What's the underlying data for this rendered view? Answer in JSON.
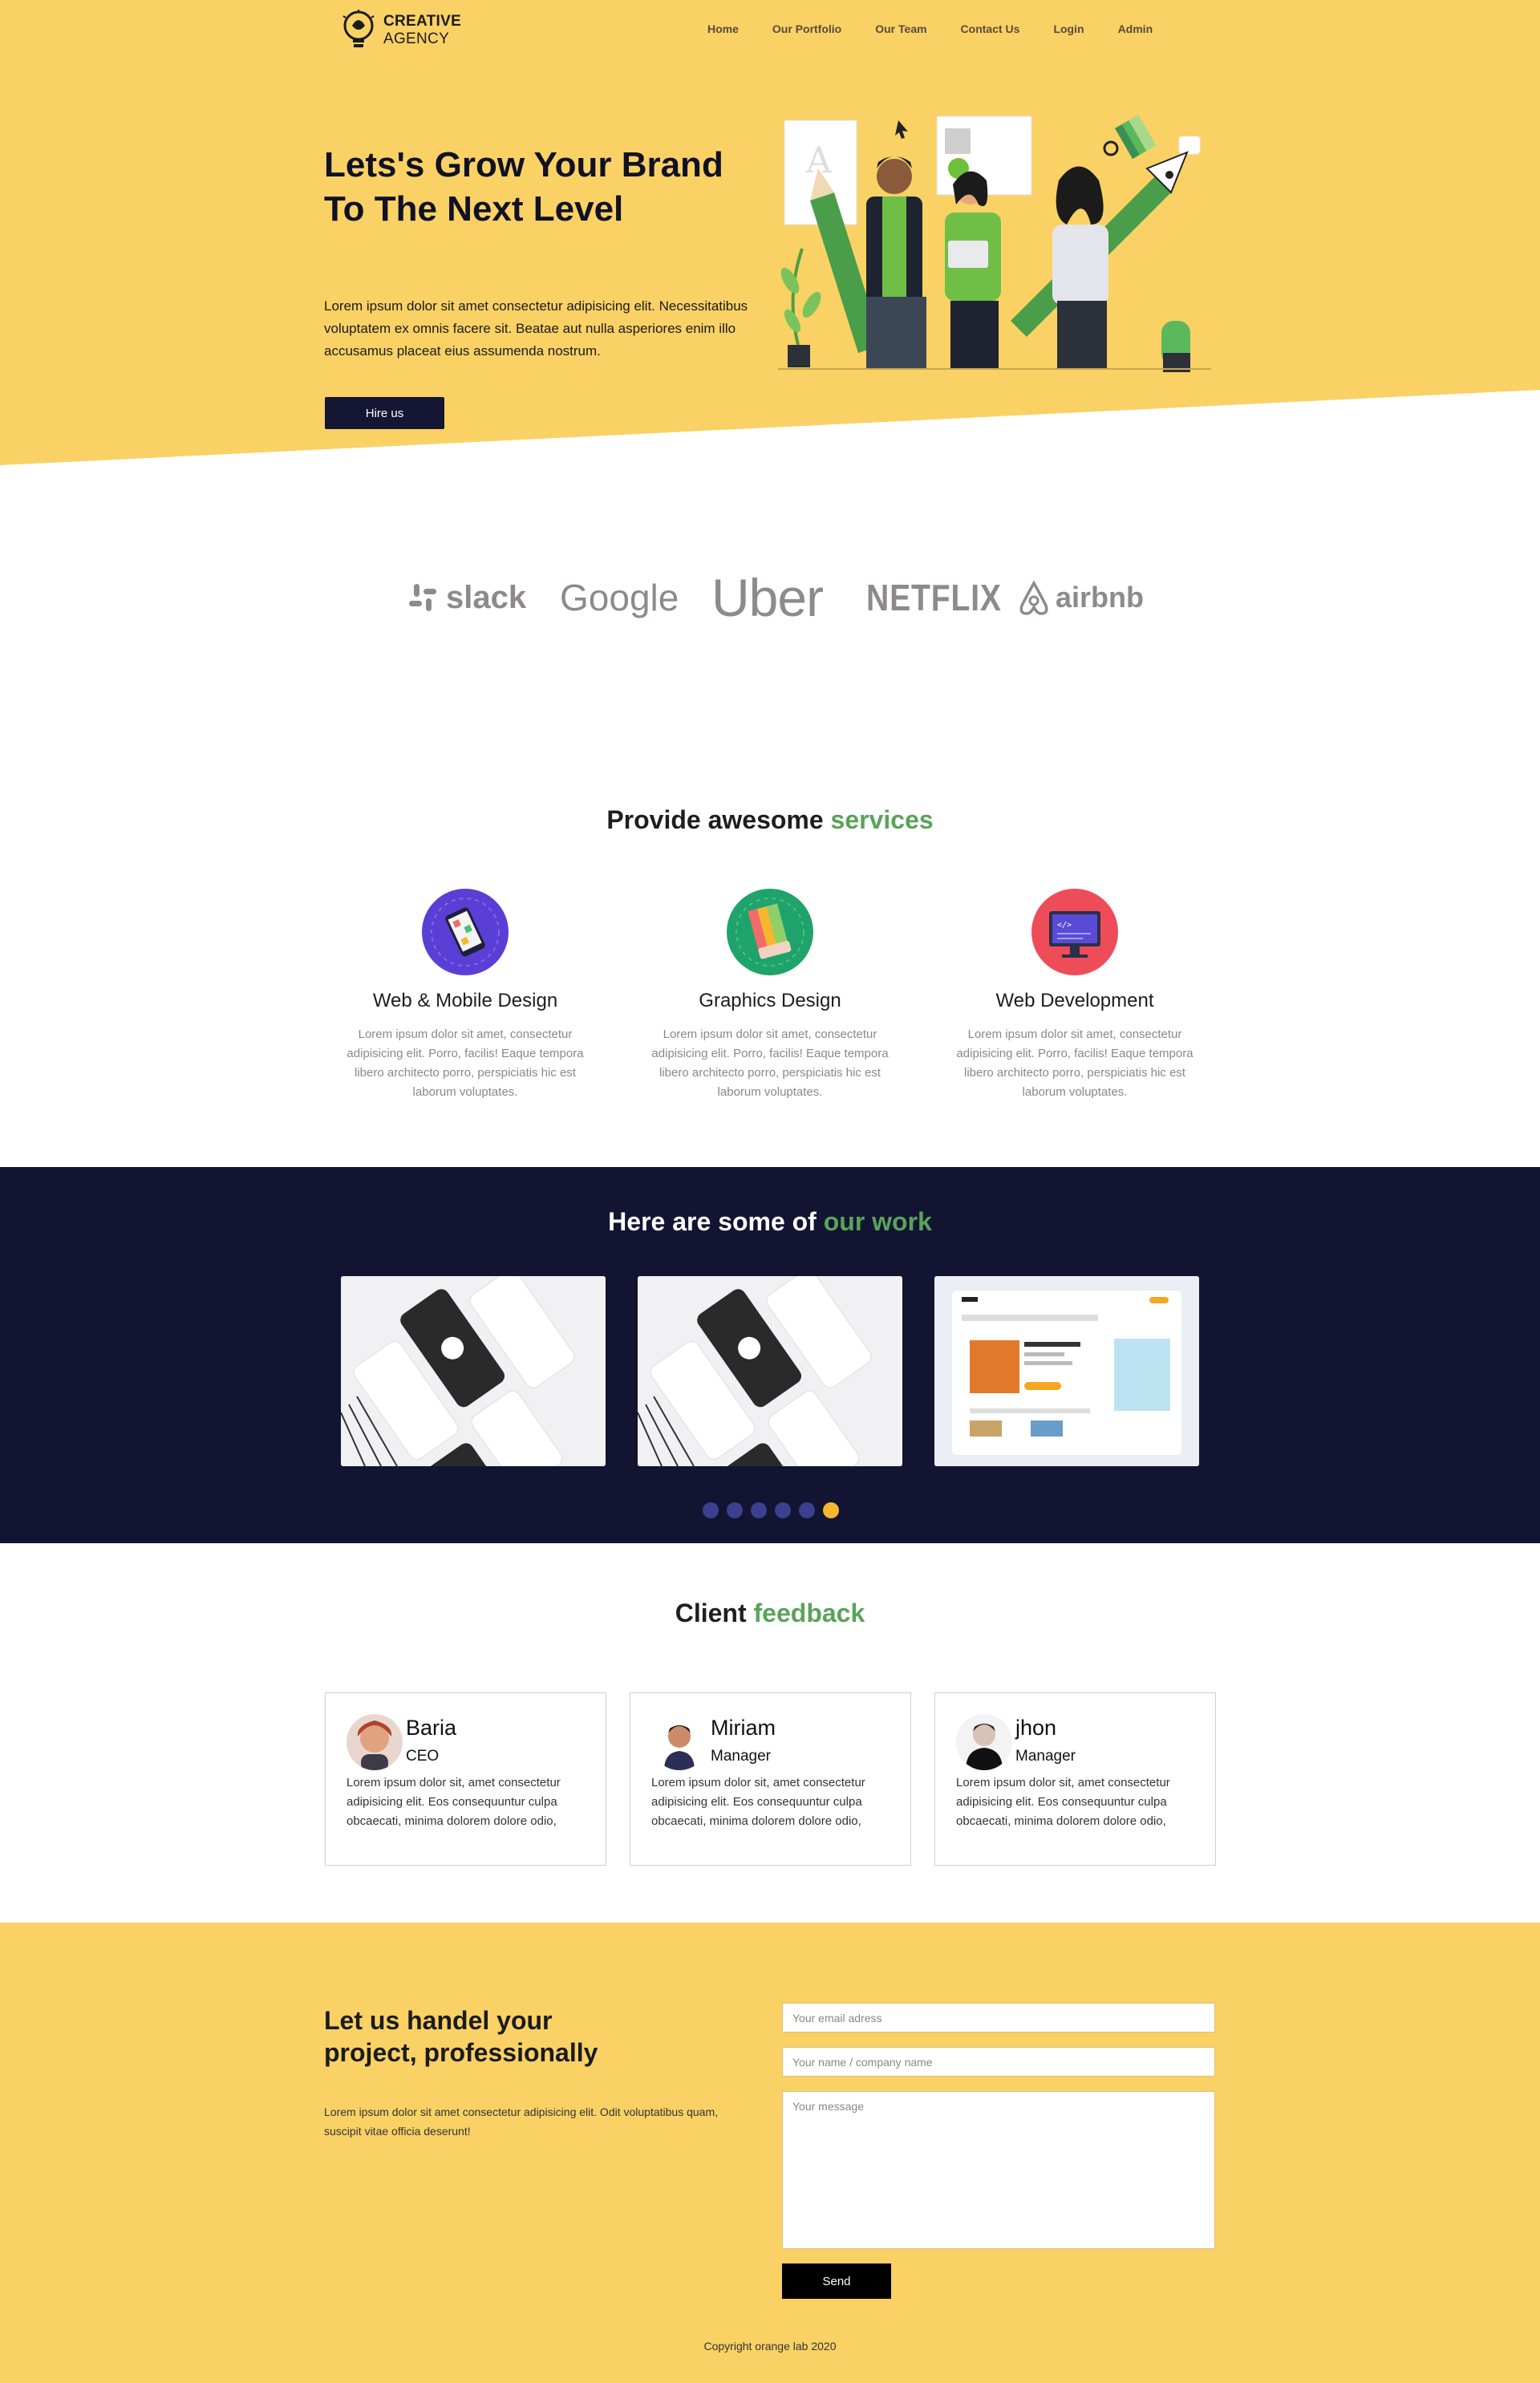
{
  "brand": {
    "name_line1": "CREATIVE",
    "name_line2": "AGENCY"
  },
  "nav": [
    {
      "label": "Home"
    },
    {
      "label": "Our Portfolio"
    },
    {
      "label": "Our Team"
    },
    {
      "label": "Contact Us"
    },
    {
      "label": "Login"
    },
    {
      "label": "Admin"
    }
  ],
  "hero": {
    "title": "Lets's Grow Your Brand To The Next Level",
    "text": "Lorem ipsum dolor sit amet consectetur adipisicing elit. Necessitatibus voluptatem ex omnis facere sit. Beatae aut nulla asperiores enim illo accusamus placeat eius assumenda nostrum.",
    "button": "Hire us"
  },
  "clients": [
    "slack",
    "Google",
    "Uber",
    "NETFLIX",
    "airbnb"
  ],
  "services": {
    "title_plain": "Provide awesome ",
    "title_accent": "services",
    "items": [
      {
        "name": "Web & Mobile Design",
        "desc": "Lorem ipsum dolor sit amet, consectetur adipisicing elit. Porro, facilis! Eaque tempora libero architecto porro, perspiciatis hic est laborum voluptates."
      },
      {
        "name": "Graphics Design",
        "desc": "Lorem ipsum dolor sit amet, consectetur adipisicing elit. Porro, facilis! Eaque tempora libero architecto porro, perspiciatis hic est laborum voluptates."
      },
      {
        "name": "Web Development",
        "desc": "Lorem ipsum dolor sit amet, consectetur adipisicing elit. Porro, facilis! Eaque tempora libero architecto porro, perspiciatis hic est laborum voluptates."
      }
    ]
  },
  "work": {
    "title_plain": "Here are some of ",
    "title_accent": "our work",
    "slides_total": 6,
    "active_slide": 6
  },
  "feedback": {
    "title_plain": "Client ",
    "title_accent": "feedback",
    "items": [
      {
        "name": "Baria",
        "role": "CEO",
        "text": "Lorem ipsum dolor sit, amet consectetur adipisicing elit. Eos consequuntur culpa obcaecati, minima dolorem dolore odio,"
      },
      {
        "name": "Miriam",
        "role": "Manager",
        "text": "Lorem ipsum dolor sit, amet consectetur adipisicing elit. Eos consequuntur culpa obcaecati, minima dolorem dolore odio,"
      },
      {
        "name": "jhon",
        "role": "Manager",
        "text": "Lorem ipsum dolor sit, amet consectetur adipisicing elit. Eos consequuntur culpa obcaecati, minima dolorem dolore odio,"
      }
    ]
  },
  "contact": {
    "title": "Let us handel your project, professionally",
    "text": "Lorem ipsum dolor sit amet consectetur adipisicing elit. Odit voluptatibus quam, suscipit vitae officia deserunt!",
    "email_placeholder": "Your email adress",
    "name_placeholder": "Your name / company name",
    "message_placeholder": "Your message",
    "send": "Send",
    "copyright": "Copyright orange lab 2020"
  },
  "colors": {
    "brand_yellow": "#f9d165",
    "navy": "#121432",
    "accent_green": "#5aa35a",
    "dot_active": "#f5b72d",
    "dot_inactive": "#3d3f8f"
  }
}
